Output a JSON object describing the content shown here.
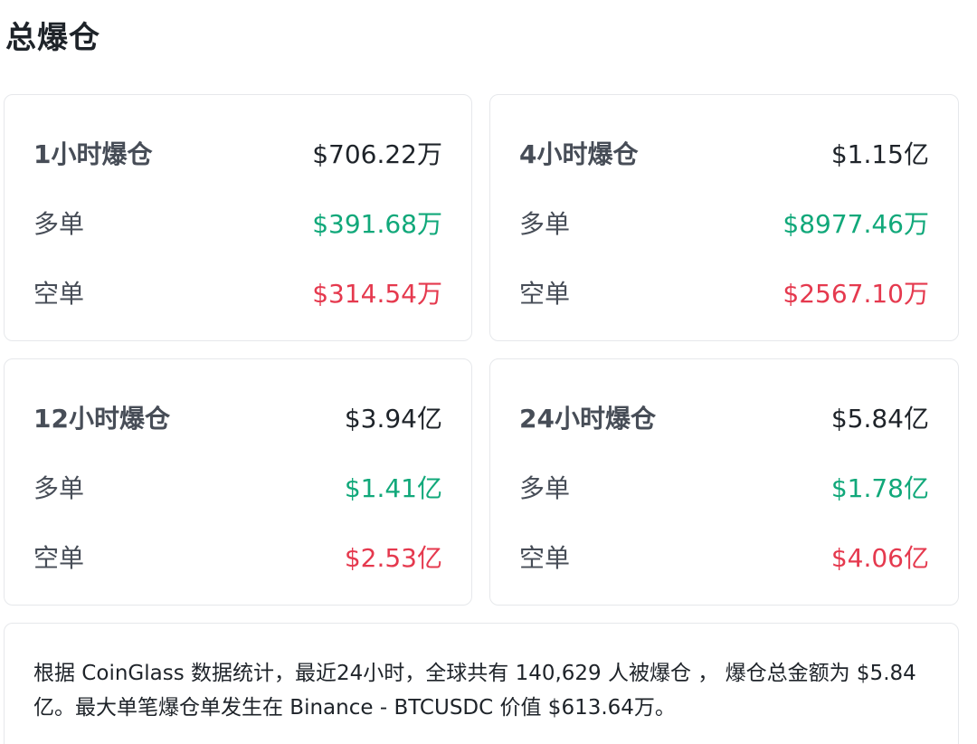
{
  "page": {
    "title": "总爆仓"
  },
  "cards": [
    {
      "id": "1h",
      "title": "1小时爆仓",
      "total": "$706.22万",
      "long_label": "多单",
      "long_value": "$391.68万",
      "short_label": "空单",
      "short_value": "$314.54万"
    },
    {
      "id": "4h",
      "title": "4小时爆仓",
      "total": "$1.15亿",
      "long_label": "多单",
      "long_value": "$8977.46万",
      "short_label": "空单",
      "short_value": "$2567.10万"
    },
    {
      "id": "12h",
      "title": "12小时爆仓",
      "total": "$3.94亿",
      "long_label": "多单",
      "long_value": "$1.41亿",
      "short_label": "空单",
      "short_value": "$2.53亿"
    },
    {
      "id": "24h",
      "title": "24小时爆仓",
      "total": "$5.84亿",
      "long_label": "多单",
      "long_value": "$1.78亿",
      "short_label": "空单",
      "short_value": "$4.06亿"
    }
  ],
  "summary": {
    "text": "根据 CoinGlass 数据统计，最近24小时，全球共有 140,629 人被爆仓 ， 爆仓总金额为 $5.84 亿。最大单笔爆仓单发生在 Binance - BTCUSDC 价值 $613.64万。"
  },
  "colors": {
    "long": "#11a87a",
    "short": "#e5394e",
    "text_primary": "#1e2329",
    "text_secondary": "#474d57",
    "border": "#e6e8eb"
  }
}
